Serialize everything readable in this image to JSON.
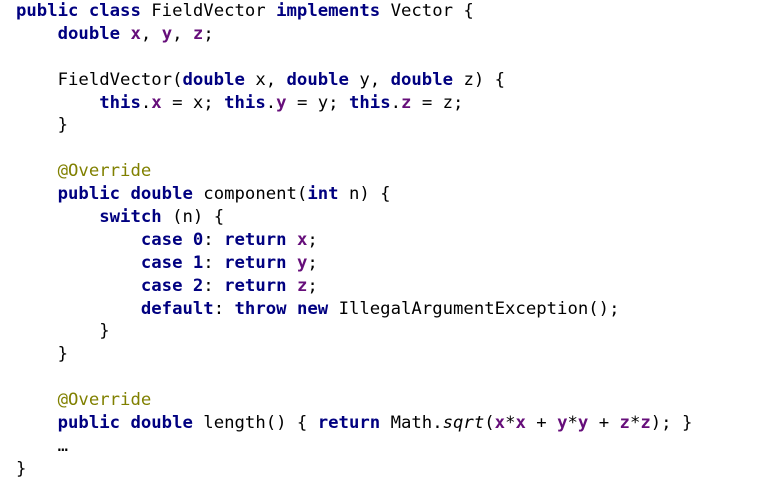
{
  "code": {
    "lines": [
      [
        {
          "t": "public class ",
          "c": "kw"
        },
        {
          "t": "FieldVector ",
          "c": "pl"
        },
        {
          "t": "implements ",
          "c": "kw"
        },
        {
          "t": "Vector {",
          "c": "pl"
        }
      ],
      [
        {
          "t": "    ",
          "c": "pl"
        },
        {
          "t": "double ",
          "c": "kw"
        },
        {
          "t": "x",
          "c": "fld"
        },
        {
          "t": ", ",
          "c": "pl"
        },
        {
          "t": "y",
          "c": "fld"
        },
        {
          "t": ", ",
          "c": "pl"
        },
        {
          "t": "z",
          "c": "fld"
        },
        {
          "t": ";",
          "c": "pl"
        }
      ],
      [],
      [
        {
          "t": "    FieldVector(",
          "c": "pl"
        },
        {
          "t": "double ",
          "c": "kw"
        },
        {
          "t": "x, ",
          "c": "pl"
        },
        {
          "t": "double ",
          "c": "kw"
        },
        {
          "t": "y, ",
          "c": "pl"
        },
        {
          "t": "double ",
          "c": "kw"
        },
        {
          "t": "z) {",
          "c": "pl"
        }
      ],
      [
        {
          "t": "        ",
          "c": "pl"
        },
        {
          "t": "this",
          "c": "kw"
        },
        {
          "t": ".",
          "c": "pl"
        },
        {
          "t": "x",
          "c": "fld"
        },
        {
          "t": " = x; ",
          "c": "pl"
        },
        {
          "t": "this",
          "c": "kw"
        },
        {
          "t": ".",
          "c": "pl"
        },
        {
          "t": "y",
          "c": "fld"
        },
        {
          "t": " = y; ",
          "c": "pl"
        },
        {
          "t": "this",
          "c": "kw"
        },
        {
          "t": ".",
          "c": "pl"
        },
        {
          "t": "z",
          "c": "fld"
        },
        {
          "t": " = z;",
          "c": "pl"
        }
      ],
      [
        {
          "t": "    }",
          "c": "pl"
        }
      ],
      [],
      [
        {
          "t": "    ",
          "c": "pl"
        },
        {
          "t": "@Override",
          "c": "ann"
        }
      ],
      [
        {
          "t": "    ",
          "c": "pl"
        },
        {
          "t": "public double ",
          "c": "kw"
        },
        {
          "t": "component(",
          "c": "pl"
        },
        {
          "t": "int ",
          "c": "kw"
        },
        {
          "t": "n) {",
          "c": "pl"
        }
      ],
      [
        {
          "t": "        ",
          "c": "pl"
        },
        {
          "t": "switch ",
          "c": "kw"
        },
        {
          "t": "(n) {",
          "c": "pl"
        }
      ],
      [
        {
          "t": "            ",
          "c": "pl"
        },
        {
          "t": "case 0",
          "c": "kw"
        },
        {
          "t": ": ",
          "c": "pl"
        },
        {
          "t": "return ",
          "c": "kw"
        },
        {
          "t": "x",
          "c": "fld"
        },
        {
          "t": ";",
          "c": "pl"
        }
      ],
      [
        {
          "t": "            ",
          "c": "pl"
        },
        {
          "t": "case 1",
          "c": "kw"
        },
        {
          "t": ": ",
          "c": "pl"
        },
        {
          "t": "return ",
          "c": "kw"
        },
        {
          "t": "y",
          "c": "fld"
        },
        {
          "t": ";",
          "c": "pl"
        }
      ],
      [
        {
          "t": "            ",
          "c": "pl"
        },
        {
          "t": "case 2",
          "c": "kw"
        },
        {
          "t": ": ",
          "c": "pl"
        },
        {
          "t": "return ",
          "c": "kw"
        },
        {
          "t": "z",
          "c": "fld"
        },
        {
          "t": ";",
          "c": "pl"
        }
      ],
      [
        {
          "t": "            ",
          "c": "pl"
        },
        {
          "t": "default",
          "c": "kw"
        },
        {
          "t": ": ",
          "c": "pl"
        },
        {
          "t": "throw new ",
          "c": "kw"
        },
        {
          "t": "IllegalArgumentException();",
          "c": "pl"
        }
      ],
      [
        {
          "t": "        }",
          "c": "pl"
        }
      ],
      [
        {
          "t": "    }",
          "c": "pl"
        }
      ],
      [],
      [
        {
          "t": "    ",
          "c": "pl"
        },
        {
          "t": "@Override",
          "c": "ann"
        }
      ],
      [
        {
          "t": "    ",
          "c": "pl"
        },
        {
          "t": "public double ",
          "c": "kw"
        },
        {
          "t": "length() { ",
          "c": "pl"
        },
        {
          "t": "return ",
          "c": "kw"
        },
        {
          "t": "Math.",
          "c": "pl"
        },
        {
          "t": "sqrt",
          "c": "it"
        },
        {
          "t": "(",
          "c": "pl"
        },
        {
          "t": "x",
          "c": "fld"
        },
        {
          "t": "*",
          "c": "pl"
        },
        {
          "t": "x",
          "c": "fld"
        },
        {
          "t": " + ",
          "c": "pl"
        },
        {
          "t": "y",
          "c": "fld"
        },
        {
          "t": "*",
          "c": "pl"
        },
        {
          "t": "y",
          "c": "fld"
        },
        {
          "t": " + ",
          "c": "pl"
        },
        {
          "t": "z",
          "c": "fld"
        },
        {
          "t": "*",
          "c": "pl"
        },
        {
          "t": "z",
          "c": "fld"
        },
        {
          "t": "); }",
          "c": "pl"
        }
      ],
      [
        {
          "t": "    …",
          "c": "pl"
        }
      ],
      [
        {
          "t": "}",
          "c": "pl"
        }
      ]
    ]
  }
}
